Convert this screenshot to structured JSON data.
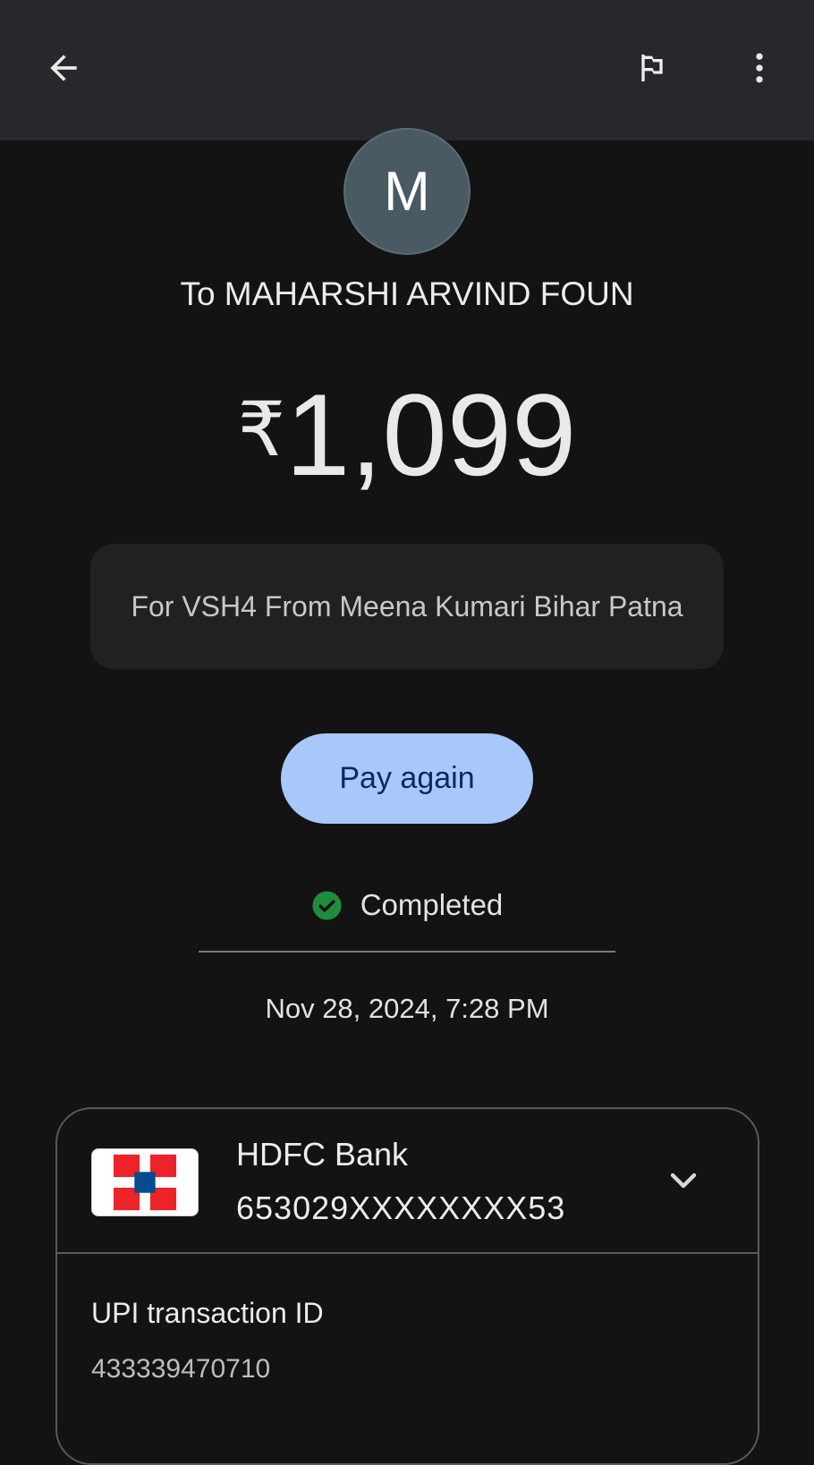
{
  "header": {
    "back_icon": "arrow-left-icon",
    "flag_icon": "flag-icon",
    "more_icon": "more-vert-icon"
  },
  "payee": {
    "avatar_letter": "M",
    "avatar_color": "#4a5a64",
    "recipient": "To MAHARSHI ARVIND FOUN"
  },
  "amount": {
    "currency_symbol": "₹",
    "value": "1,099"
  },
  "note": "For VSH4 From Meena Kumari Bihar Patna",
  "actions": {
    "pay_again_label": "Pay again",
    "pay_again_color": "#a8c7fa"
  },
  "status": {
    "text": "Completed",
    "icon": "check-circle-icon",
    "color": "#1e8e3e"
  },
  "datetime": "Nov 28, 2024, 7:28 PM",
  "bank": {
    "name": "HDFC Bank",
    "account": "653029XXXXXXXX53",
    "logo_colors": [
      "#ed232a",
      "#004c8f",
      "#ffffff"
    ]
  },
  "transaction": {
    "label": "UPI transaction ID",
    "id": "433339470710"
  }
}
